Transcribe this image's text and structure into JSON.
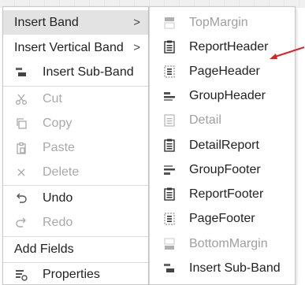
{
  "menu": {
    "items": [
      {
        "label": "Insert Band",
        "arrow": ">",
        "icon": "none",
        "disabled": false,
        "highlight": true
      },
      {
        "label": "Insert Vertical Band",
        "arrow": ">",
        "icon": "none",
        "disabled": false,
        "highlight": false
      },
      {
        "label": "Insert Sub-Band",
        "icon": "sub-band-icon",
        "disabled": false
      },
      {
        "label": "Cut",
        "icon": "scissors-icon",
        "disabled": true
      },
      {
        "label": "Copy",
        "icon": "copy-icon",
        "disabled": true
      },
      {
        "label": "Paste",
        "icon": "paste-icon",
        "disabled": true
      },
      {
        "label": "Delete",
        "icon": "close-icon",
        "disabled": true
      },
      {
        "label": "Undo",
        "icon": "undo-icon",
        "disabled": false
      },
      {
        "label": "Redo",
        "icon": "redo-icon",
        "disabled": true
      },
      {
        "label": "Add Fields",
        "icon": "none",
        "disabled": false
      },
      {
        "label": "Properties",
        "icon": "properties-icon",
        "disabled": false
      }
    ]
  },
  "submenu": {
    "items": [
      {
        "label": "TopMargin",
        "icon": "top-margin-icon",
        "disabled": true
      },
      {
        "label": "ReportHeader",
        "icon": "report-header-icon",
        "disabled": false
      },
      {
        "label": "PageHeader",
        "icon": "page-header-icon",
        "disabled": false
      },
      {
        "label": "GroupHeader",
        "icon": "group-header-icon",
        "disabled": false
      },
      {
        "label": "Detail",
        "icon": "detail-icon",
        "disabled": true
      },
      {
        "label": "DetailReport",
        "icon": "detail-report-icon",
        "disabled": false
      },
      {
        "label": "GroupFooter",
        "icon": "group-footer-icon",
        "disabled": false
      },
      {
        "label": "ReportFooter",
        "icon": "report-footer-icon",
        "disabled": false
      },
      {
        "label": "PageFooter",
        "icon": "page-footer-icon",
        "disabled": false
      },
      {
        "label": "BottomMargin",
        "icon": "bottom-margin-icon",
        "disabled": true
      },
      {
        "label": "Insert Sub-Band",
        "icon": "sub-band-icon",
        "disabled": false
      }
    ]
  },
  "colors": {
    "highlight": "#e3e3e3",
    "annotation_arrow": "#e02020",
    "disabled_text": "#a9a9a9"
  }
}
